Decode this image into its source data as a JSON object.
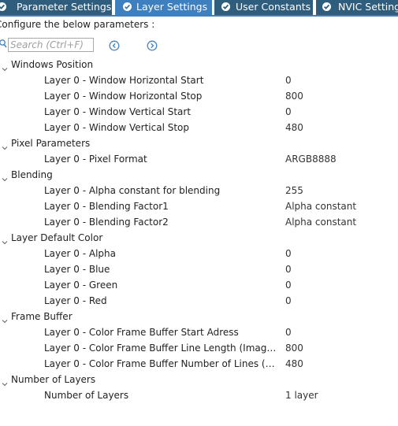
{
  "tabs": [
    {
      "label": "Parameter Settings",
      "active": false
    },
    {
      "label": "Layer Settings",
      "active": true
    },
    {
      "label": "User Constants",
      "active": false
    },
    {
      "label": "NVIC Settings",
      "active": false
    }
  ],
  "subtitle": "Configure the below parameters :",
  "search": {
    "placeholder": "Search (Ctrl+F)"
  },
  "colors": {
    "tab_bg": "#2f5d7e",
    "tab_active_bg": "#3d7fbf"
  },
  "groups": [
    {
      "label": "Windows Position",
      "params": [
        {
          "label": "Layer 0 - Window Horizontal Start",
          "value": "0"
        },
        {
          "label": "Layer 0 - Window Horizontal Stop",
          "value": "800"
        },
        {
          "label": "Layer 0 - Window Vertical Start",
          "value": "0"
        },
        {
          "label": "Layer 0 - Window Vertical Stop",
          "value": "480"
        }
      ]
    },
    {
      "label": "Pixel Parameters",
      "params": [
        {
          "label": "Layer 0 - Pixel Format",
          "value": "ARGB8888"
        }
      ]
    },
    {
      "label": "Blending",
      "params": [
        {
          "label": "Layer 0 - Alpha constant for blending",
          "value": "255"
        },
        {
          "label": "Layer 0 - Blending Factor1",
          "value": "Alpha constant"
        },
        {
          "label": "Layer 0 - Blending Factor2",
          "value": "Alpha constant"
        }
      ]
    },
    {
      "label": "Layer Default Color",
      "params": [
        {
          "label": "Layer 0 - Alpha",
          "value": "0"
        },
        {
          "label": "Layer 0 - Blue",
          "value": "0"
        },
        {
          "label": "Layer 0 - Green",
          "value": "0"
        },
        {
          "label": "Layer 0 - Red",
          "value": "0"
        }
      ]
    },
    {
      "label": "Frame Buffer",
      "params": [
        {
          "label": "Layer 0 - Color Frame Buffer Start Adress",
          "value": "0"
        },
        {
          "label": "Layer 0 - Color Frame Buffer Line Length (Image ...",
          "value": "800"
        },
        {
          "label": "Layer 0 - Color Frame Buffer Number of Lines (Ima...",
          "value": "480"
        }
      ]
    },
    {
      "label": "Number of Layers",
      "params": [
        {
          "label": "Number of Layers",
          "value": "1 layer"
        }
      ]
    }
  ]
}
